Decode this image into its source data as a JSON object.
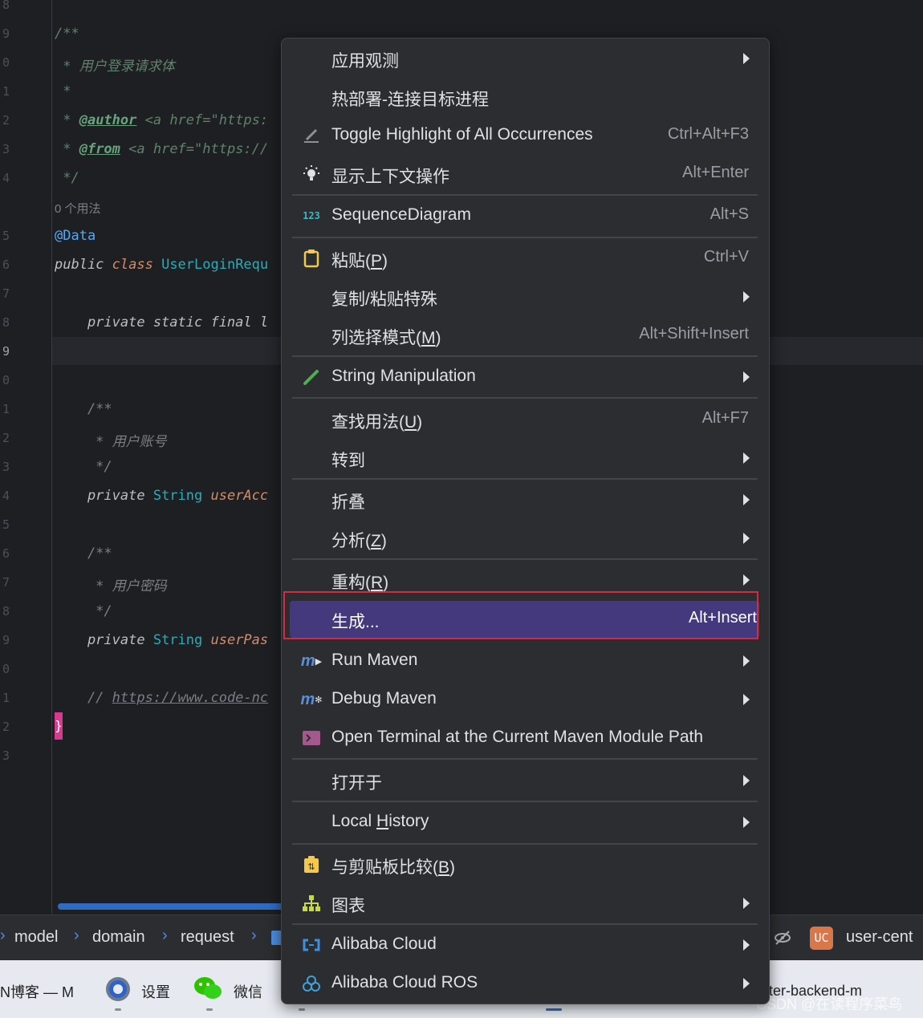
{
  "editor": {
    "line_numbers": [
      "8",
      "9",
      "0",
      "1",
      "2",
      "3",
      "4",
      "5",
      "6",
      "7",
      "8",
      "9",
      "0",
      "1",
      "2",
      "3",
      "4",
      "5",
      "6",
      "7",
      "8",
      "9",
      "0",
      "1",
      "2",
      "3"
    ],
    "active_line": "9",
    "code": {
      "doc_open": "/**",
      "doc_desc": " * 用户登录请求体",
      "doc_blank": " *",
      "doc_author_star": " * ",
      "doc_author_tag": "@author",
      "doc_author_rest": " <a href=\"https:",
      "doc_from_star": " * ",
      "doc_from_tag": "@from",
      "doc_from_rest": " <a href=\"https://",
      "doc_close": " */",
      "usage_hint": "0 个用法",
      "annotation": "@Data",
      "class_kw1": "public",
      "class_kw2": " class ",
      "class_name": "UserLoginRequ",
      "static_line": "    private static final l",
      "f1_doc_open": "    /**",
      "f1_doc_desc": "     * 用户账号",
      "f1_doc_close": "     */",
      "f1_private": "    private ",
      "f1_type": "String ",
      "f1_name": "userAcc",
      "f2_doc_open": "    /**",
      "f2_doc_desc": "     * 用户密码",
      "f2_doc_close": "     */",
      "f2_private": "    private ",
      "f2_type": "String ",
      "f2_name": "userPas",
      "comment_prefix": "    // ",
      "comment_url": "https://www.code-nc",
      "brace": "}"
    }
  },
  "breadcrumb": {
    "items": [
      "model",
      "domain",
      "request"
    ],
    "separator": "›",
    "project_badge": "UC",
    "project_name": "user-cent"
  },
  "taskbar": {
    "items": [
      "N博客 — M",
      "设置",
      "微信",
      "ter-backend-m"
    ]
  },
  "watermark": "CSDN @在读程序菜鸟",
  "context_menu": {
    "items": [
      {
        "label": "应用观测",
        "shortcut": "",
        "submenu": true,
        "icon": ""
      },
      {
        "label": "热部署-连接目标进程",
        "shortcut": "",
        "submenu": false,
        "icon": ""
      },
      {
        "label": "Toggle Highlight of All Occurrences",
        "shortcut": "Ctrl+Alt+F3",
        "submenu": false,
        "icon": "highlight-icon"
      },
      {
        "label": "显示上下文操作",
        "shortcut": "Alt+Enter",
        "submenu": false,
        "icon": "bulb-icon"
      },
      {
        "label": "SequenceDiagram",
        "shortcut": "Alt+S",
        "submenu": false,
        "icon": "sequence-123-icon"
      },
      {
        "label_pre": "粘贴(",
        "label_mn": "P",
        "label_post": ")",
        "shortcut": "Ctrl+V",
        "submenu": false,
        "icon": "clipboard-icon"
      },
      {
        "label": "复制/粘贴特殊",
        "shortcut": "",
        "submenu": true,
        "icon": ""
      },
      {
        "label_pre": "列选择模式(",
        "label_mn": "M",
        "label_post": ")",
        "shortcut": "Alt+Shift+Insert",
        "submenu": false,
        "icon": ""
      },
      {
        "label": "String Manipulation",
        "shortcut": "",
        "submenu": true,
        "icon": "pencil-icon"
      },
      {
        "label_pre": "查找用法(",
        "label_mn": "U",
        "label_post": ")",
        "shortcut": "Alt+F7",
        "submenu": false,
        "icon": ""
      },
      {
        "label": "转到",
        "shortcut": "",
        "submenu": true,
        "icon": ""
      },
      {
        "label": "折叠",
        "shortcut": "",
        "submenu": true,
        "icon": ""
      },
      {
        "label_pre": "分析(",
        "label_mn": "Z",
        "label_post": ")",
        "shortcut": "",
        "submenu": true,
        "icon": ""
      },
      {
        "label_pre": "重构(",
        "label_mn": "R",
        "label_post": ")",
        "shortcut": "",
        "submenu": true,
        "icon": ""
      },
      {
        "label": "生成...",
        "shortcut": "Alt+Insert",
        "submenu": false,
        "icon": "",
        "selected": true
      },
      {
        "label": "Run Maven",
        "shortcut": "",
        "submenu": true,
        "icon": "maven-run-icon"
      },
      {
        "label": "Debug Maven",
        "shortcut": "",
        "submenu": true,
        "icon": "maven-debug-icon"
      },
      {
        "label": "Open Terminal at the Current Maven Module Path",
        "shortcut": "",
        "submenu": false,
        "icon": "terminal-icon"
      },
      {
        "label": "打开于",
        "shortcut": "",
        "submenu": true,
        "icon": ""
      },
      {
        "label_pre": "Local ",
        "label_mn": "H",
        "label_post": "istory",
        "shortcut": "",
        "submenu": true,
        "icon": ""
      },
      {
        "label_pre": "与剪贴板比较(",
        "label_mn": "B",
        "label_post": ")",
        "shortcut": "",
        "submenu": false,
        "icon": "compare-clipboard-icon"
      },
      {
        "label": "图表",
        "shortcut": "",
        "submenu": true,
        "icon": "diagram-icon"
      },
      {
        "label": "Alibaba Cloud",
        "shortcut": "",
        "submenu": true,
        "icon": "alibaba-cloud-icon"
      },
      {
        "label": "Alibaba Cloud ROS",
        "shortcut": "",
        "submenu": true,
        "icon": "alibaba-ros-icon"
      }
    ]
  },
  "colors": {
    "selected_item": "#44397d",
    "highlight_border": "#d42b3f",
    "menu_bg": "#2b2d30"
  }
}
